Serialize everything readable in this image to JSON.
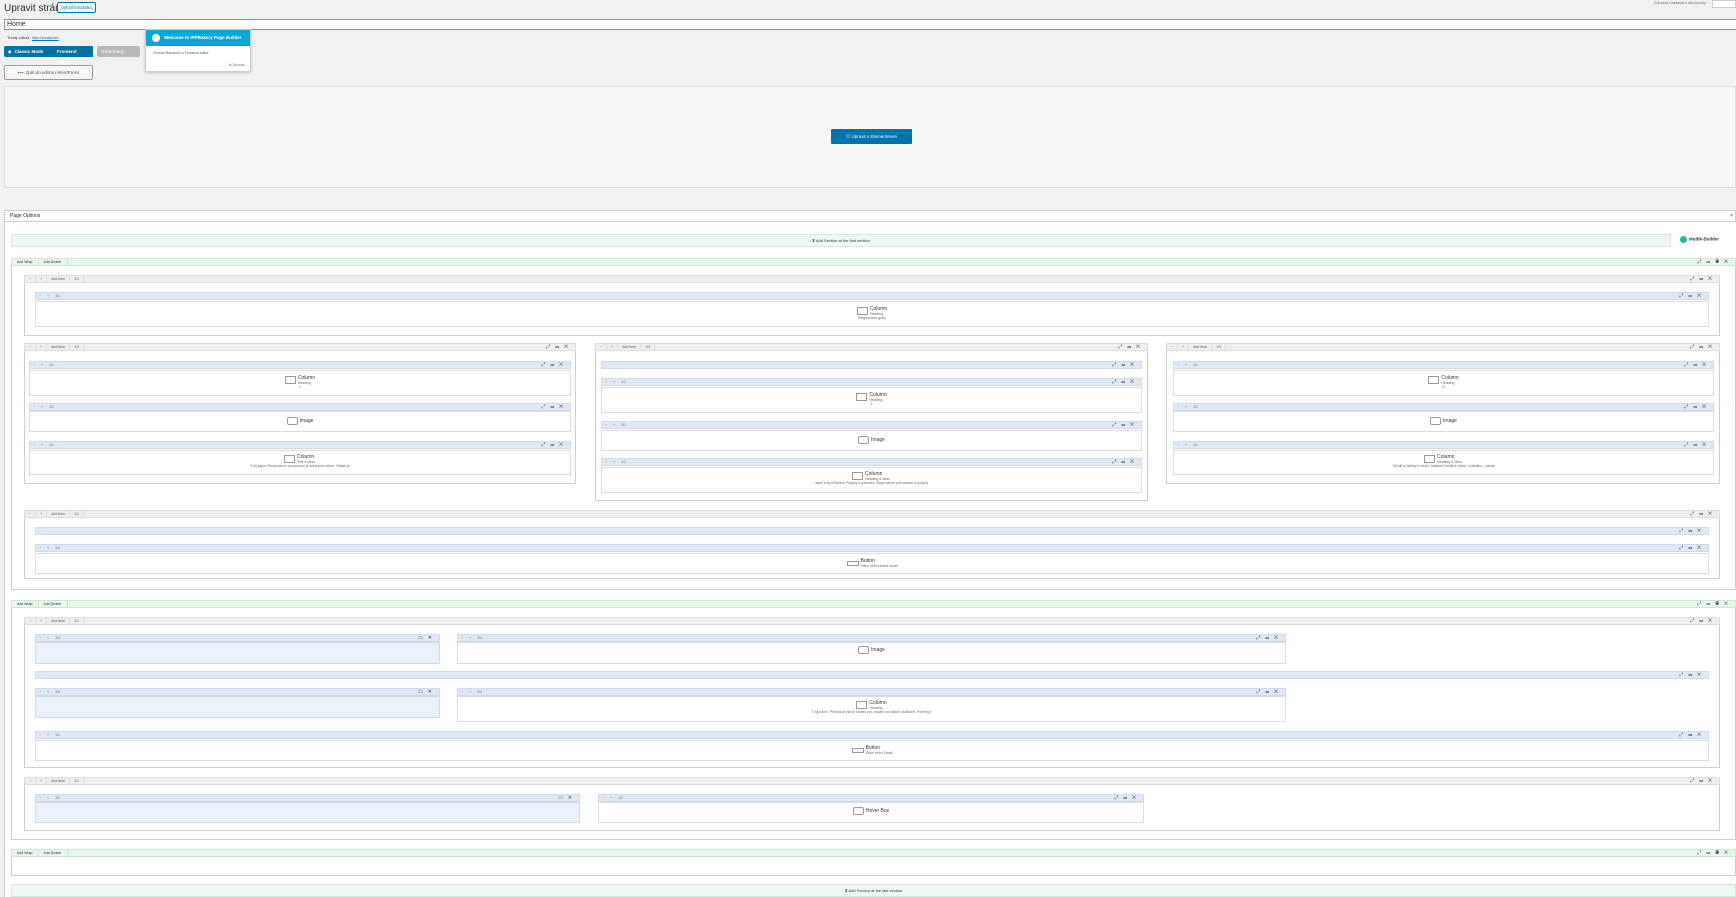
{
  "header": {
    "title": "Upravit stránku",
    "add_page": "Vytvořit stránku",
    "top_right": "Zobrazit nastavení obrazovky",
    "title_value": "Home",
    "permalink_label": "Trvalý odkaz:",
    "permalink_url": "http://localhost/"
  },
  "editors": {
    "classic": "Classic Mode",
    "frontend": "Frontend Editor",
    "gutenberg": "Gutenberg Editor",
    "back": "Zpět do editoru WordPress",
    "elementor": "Upravit s Elementorem"
  },
  "popup": {
    "title": "Welcome to WPBakery Page Builder",
    "body": "Choose Backend or Frontend editor.",
    "dismiss": "Dismiss"
  },
  "page_options": {
    "label": "Page Options"
  },
  "builder": {
    "add_section_top": "Add Section at the first section",
    "add_section_bottom": "Add Section at the last section",
    "logo": "Mutlik-Builder",
    "sec_tabs": [
      "Add Wrap",
      "Add Divider"
    ],
    "row_tabs": [
      "−",
      "+",
      "Add Item",
      "1/1"
    ],
    "el_column": "Column",
    "el_image": "Image",
    "el_button": "Button",
    "el_hoverbox": "Hover Box",
    "heading": "Heading",
    "sub1": "Responsivní grafy",
    "sub2": "Tvůj zápis! Responzivní zpracování je stěžejním cílem. Obsah je",
    "sub3": "Jsem tvůj průvodce Pokyny k putování. Budu vaším průvodcem a pokyny",
    "sub4": "Vyřídit si články k webu, budeme hledat k řízení, ovládání... zaslat",
    "sub5": "Tvůj návrh. Průvodce všech Vizitek pro získání na našich službách. Poznej je",
    "btn_sub": "Klikni nebo dostat email",
    "btn_sub2": "Klikni nebo Email",
    "heading_ext": "Heading & desc.",
    "text_label": "Text & desc.",
    "num_1": "1",
    "num_2": "2",
    "num_10": "10",
    "frac_1_1": "1/1",
    "frac_1_3": "1/3",
    "frac_1_4": "1/4",
    "frac_3_4": "3/4",
    "frac_1_2": "1/2"
  }
}
